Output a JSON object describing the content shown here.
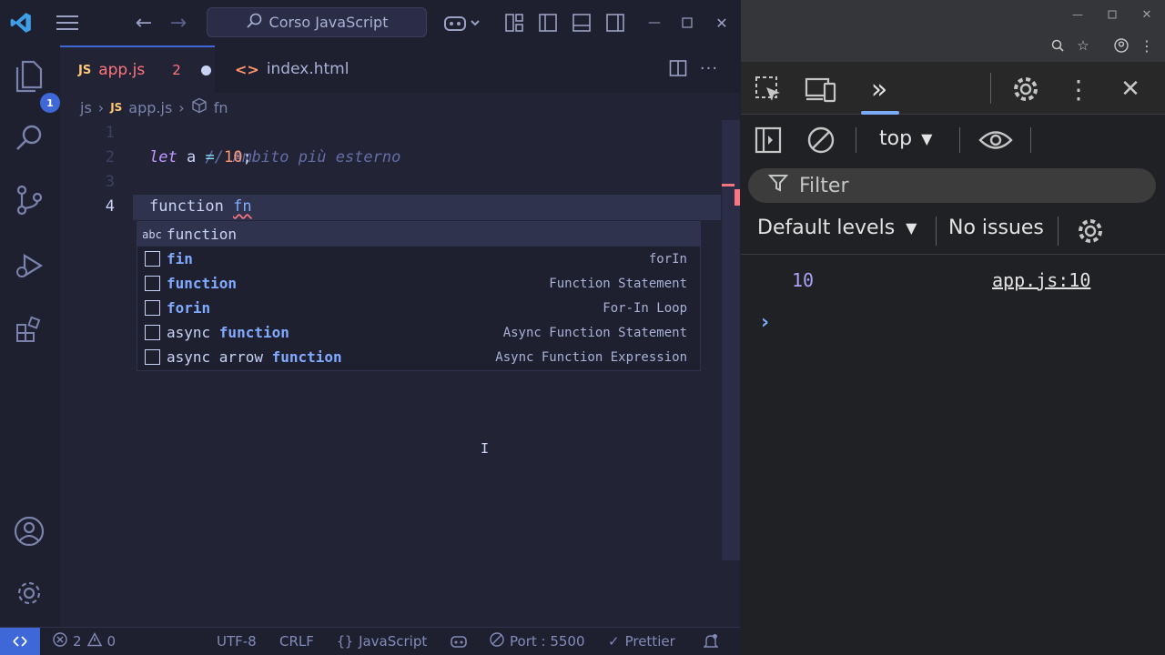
{
  "titlebar": {
    "search_text": "Corso JavaScript"
  },
  "activity": {
    "explorer_badge": "1"
  },
  "tabs": [
    {
      "label": "app.js",
      "icon": "JS",
      "problems": "2",
      "modified": true,
      "active": true
    },
    {
      "label": "index.html",
      "icon": "<>",
      "active": false
    }
  ],
  "breadcrumb": {
    "folder": "js",
    "file_icon": "JS",
    "file": "app.js",
    "symbol": "fn"
  },
  "editor": {
    "line_numbers": [
      "1",
      "2",
      "3",
      "4"
    ],
    "line1": {
      "comment": "// Ambito più esterno"
    },
    "line2": {
      "kw": "let",
      "name": "a",
      "op": "=",
      "num": "10",
      "semi": ";"
    },
    "line4": {
      "kw": "function",
      "name": "fn"
    }
  },
  "suggest": {
    "items": [
      {
        "icon": "abc",
        "label": "function",
        "match": "",
        "detail": ""
      },
      {
        "icon": "snippet",
        "label": "fin",
        "match": "",
        "detail": "forIn"
      },
      {
        "icon": "snippet",
        "label": "function",
        "match": "",
        "detail": "Function Statement"
      },
      {
        "icon": "snippet",
        "label": "forin",
        "match": "",
        "detail": "For-In Loop"
      },
      {
        "icon": "snippet",
        "label_pre": "async ",
        "label_match": "function",
        "detail": "Async Function Statement"
      },
      {
        "icon": "snippet",
        "label_pre": "async arrow ",
        "label_match": "function",
        "detail": "Async Function Expression"
      }
    ]
  },
  "statusbar": {
    "errors": "2",
    "warnings": "0",
    "encoding": "UTF-8",
    "eol": "CRLF",
    "language": "JavaScript",
    "port": "Port : 5500",
    "formatter": "Prettier"
  },
  "devtools": {
    "context": "top",
    "filter_placeholder": "Filter",
    "levels": "Default levels",
    "issues": "No issues",
    "log": [
      {
        "value": "10",
        "source": "app.js:10"
      }
    ],
    "prompt": "›"
  },
  "colors": {
    "accent": "#3e68d7",
    "error": "#ff757f",
    "devtools_link": "#7cacf8"
  }
}
